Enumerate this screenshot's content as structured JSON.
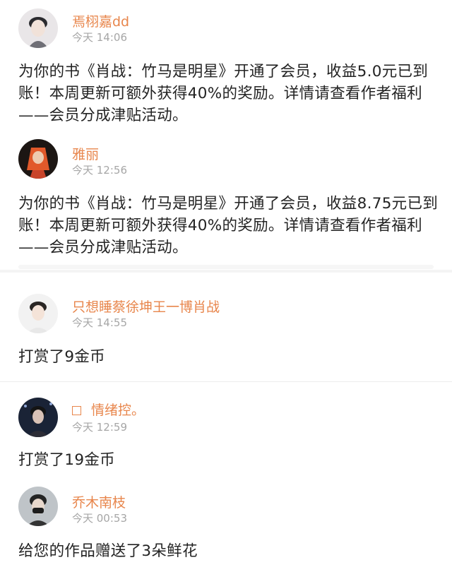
{
  "notifications": [
    {
      "username": "焉栩嘉dd",
      "time": "今天 14:06",
      "message": "为你的书《肖战：竹马是明星》开通了会员，收益5.0元已到账！本周更新可额外获得40%的奖励。详情请查看作者福利——会员分成津贴活动。"
    },
    {
      "username": "雅丽",
      "time": "今天 12:56",
      "message": "为你的书《肖战：竹马是明星》开通了会员，收益8.75元已到账！本周更新可额外获得40%的奖励。详情请查看作者福利——会员分成津贴活动。"
    },
    {
      "username": "只想睡蔡徐坤王一博肖战",
      "time": "今天 14:55",
      "message": "打赏了9金币"
    },
    {
      "username": "情绪控。",
      "time": "今天 12:59",
      "message": "打赏了19金币"
    },
    {
      "username": "乔木南枝",
      "time": "今天 00:53",
      "message": "给您的作品赠送了3朵鲜花"
    }
  ],
  "colors": {
    "username": "#e8864c",
    "time": "#a6a6a6",
    "text": "#232323"
  }
}
